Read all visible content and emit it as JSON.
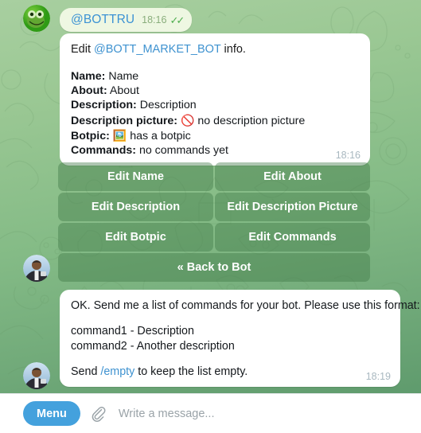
{
  "theme": {
    "bg_top": "#a8cfa0",
    "bg_bottom": "#5f9b6d",
    "outgoing_bubble": "#eef7e2",
    "incoming_bubble": "#ffffff",
    "link": "#3e92d0",
    "button_overlay": "rgba(61,119,70,.42)",
    "menu_blue": "#44a1dd",
    "check_green": "#4fae4f"
  },
  "messages": {
    "outgoing": {
      "avatar_name": "frog-avatar",
      "text": "@BOTTRU",
      "time": "18:16",
      "status_icon": "double-check-icon"
    },
    "info": {
      "avatar_name": "user-photo-avatar",
      "intro_prefix": "Edit ",
      "intro_link": "@BOTT_MARKET_BOT",
      "intro_suffix": " info.",
      "fields": [
        {
          "label": "Name:",
          "value": "Name",
          "emoji": ""
        },
        {
          "label": "About:",
          "value": "About",
          "emoji": ""
        },
        {
          "label": "Description:",
          "value": "Description",
          "emoji": ""
        },
        {
          "label": "Description picture:",
          "value": "no description picture",
          "emoji": "🚫",
          "emoji_name": "prohibited-icon"
        },
        {
          "label": "Botpic:",
          "value": "has a botpic",
          "emoji": "🖼️",
          "emoji_name": "framed-picture-icon"
        },
        {
          "label": "Commands:",
          "value": "no commands yet",
          "emoji": ""
        }
      ],
      "time": "18:16"
    },
    "keyboard": {
      "rows": [
        [
          "Edit Name",
          "Edit About"
        ],
        [
          "Edit Description",
          "Edit Description Picture"
        ],
        [
          "Edit Botpic",
          "Edit Commands"
        ],
        [
          "« Back to Bot"
        ]
      ]
    },
    "commands_prompt": {
      "avatar_name": "user-photo-avatar",
      "line1": "OK. Send me a list of commands for your bot. Please use this format:",
      "line2": "command1 - Description",
      "line3": "command2 - Another description",
      "line4_prefix": "Send ",
      "line4_link": "/empty",
      "line4_suffix": " to keep the list empty.",
      "time": "18:19"
    }
  },
  "composer": {
    "menu_label": "Menu",
    "attach_icon": "paperclip-icon",
    "input_value": "",
    "input_placeholder": "Write a message..."
  }
}
